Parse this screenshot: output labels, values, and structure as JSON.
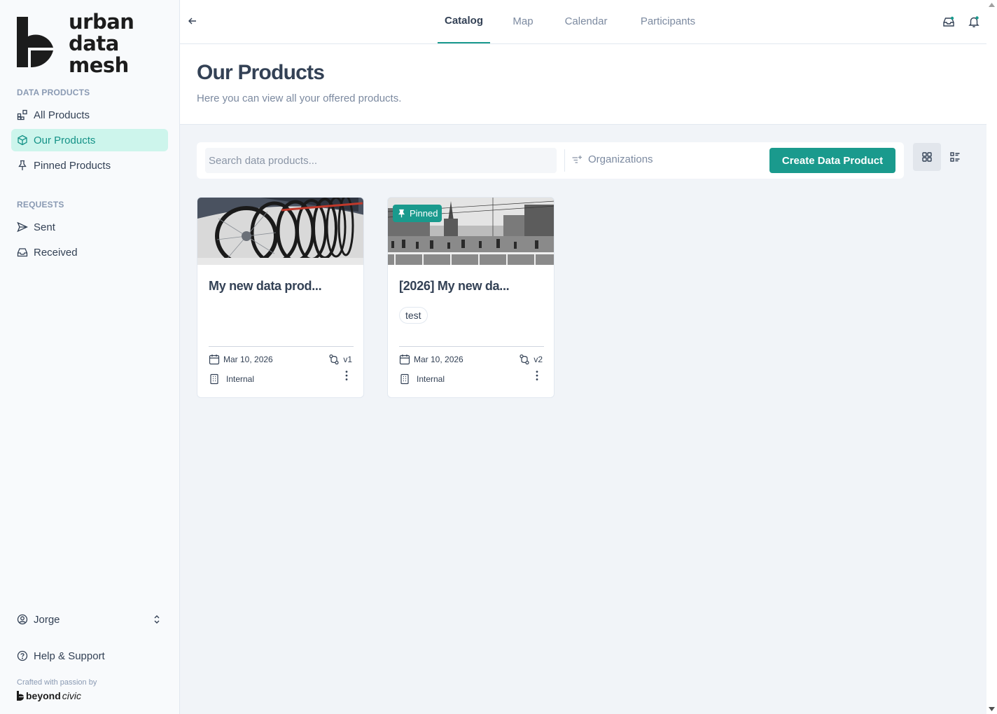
{
  "brand": {
    "line1": "urban",
    "line2": "data",
    "line3": "mesh"
  },
  "sidebar": {
    "section_products": "DATA PRODUCTS",
    "section_requests": "REQUESTS",
    "items": [
      {
        "label": "All Products",
        "icon": "boxes-icon"
      },
      {
        "label": "Our Products",
        "icon": "cube-icon",
        "active": true
      },
      {
        "label": "Pinned Products",
        "icon": "pin-icon"
      },
      {
        "label": "Sent",
        "icon": "send-icon"
      },
      {
        "label": "Received",
        "icon": "inbox-icon"
      }
    ],
    "user": "Jorge",
    "help": "Help & Support",
    "crafted": "Crafted with passion by",
    "partner_a": "beyond",
    "partner_b": "civic"
  },
  "tabs": [
    {
      "label": "Catalog",
      "active": true
    },
    {
      "label": "Map"
    },
    {
      "label": "Calendar"
    },
    {
      "label": "Participants"
    }
  ],
  "header": {
    "title": "Our Products",
    "subtitle": "Here you can view all your offered products."
  },
  "toolbar": {
    "search_placeholder": "Search data products...",
    "organizations": "Organizations",
    "create_label": "Create Data Product"
  },
  "products": [
    {
      "title": "My new data prod...",
      "date": "Mar 10, 2026",
      "version": "v1",
      "visibility": "Internal",
      "pinned": false,
      "tags": []
    },
    {
      "title": "[2026] My new da...",
      "date": "Mar 10, 2026",
      "version": "v2",
      "visibility": "Internal",
      "pinned": true,
      "pinned_label": "Pinned",
      "tags": [
        "test"
      ]
    }
  ],
  "colors": {
    "accent": "#1a9a8d",
    "active_bg": "#cdf5ec",
    "main_bg": "#f1f4f8"
  }
}
